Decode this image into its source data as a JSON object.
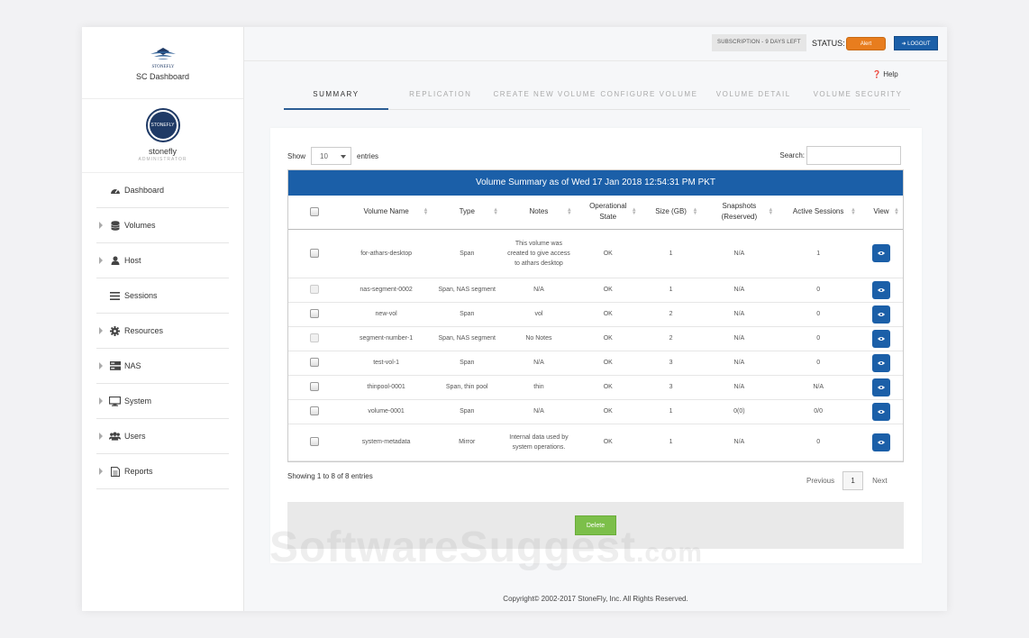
{
  "brand": {
    "logo_text": "STONEFLY",
    "title": "SC Dashboard"
  },
  "profile": {
    "avatar_text": "STONEFLY",
    "name": "stonefly",
    "role": "ADMINISTRATOR"
  },
  "sidebar": {
    "items": [
      {
        "label": "Dashboard",
        "icon": "dashboard-icon"
      },
      {
        "label": "Volumes",
        "icon": "database-icon"
      },
      {
        "label": "Host",
        "icon": "user-icon"
      },
      {
        "label": "Sessions",
        "icon": "list-icon"
      },
      {
        "label": "Resources",
        "icon": "gear-icon"
      },
      {
        "label": "NAS",
        "icon": "server-icon"
      },
      {
        "label": "System",
        "icon": "monitor-icon"
      },
      {
        "label": "Users",
        "icon": "users-icon"
      },
      {
        "label": "Reports",
        "icon": "report-icon"
      }
    ]
  },
  "topbar": {
    "subscription": "SUBSCRIPTION - 9 DAYS LEFT",
    "status_label": "STATUS:",
    "alert": "Alert",
    "logout": "LOGOUT"
  },
  "help": "Help",
  "tabs": [
    "SUMMARY",
    "REPLICATION",
    "CREATE NEW VOLUME",
    "CONFIGURE VOLUME",
    "VOLUME DETAIL",
    "VOLUME SECURITY"
  ],
  "controls": {
    "show_label": "Show",
    "show_value": "10",
    "entries_label": "entries",
    "search_label": "Search:"
  },
  "table": {
    "title": "Volume Summary as of Wed 17 Jan 2018 12:54:31 PM PKT",
    "columns": [
      "Volume Name",
      "Type",
      "Notes",
      "Operational State",
      "Size (GB)",
      "Snapshots (Reserved)",
      "Active Sessions",
      "View"
    ],
    "rows": [
      {
        "name": "for-athars-desktop",
        "type": "Span",
        "notes": "This volume was created to give access to athars desktop",
        "state": "OK",
        "size": "1",
        "snapshots": "N/A",
        "sessions": "1"
      },
      {
        "name": "nas-segment-0002",
        "type": "Span, NAS segment",
        "notes": "N/A",
        "state": "OK",
        "size": "1",
        "snapshots": "N/A",
        "sessions": "0"
      },
      {
        "name": "new-vol",
        "type": "Span",
        "notes": "vol",
        "state": "OK",
        "size": "2",
        "snapshots": "N/A",
        "sessions": "0"
      },
      {
        "name": "segment-number-1",
        "type": "Span, NAS segment",
        "notes": "No Notes",
        "state": "OK",
        "size": "2",
        "snapshots": "N/A",
        "sessions": "0"
      },
      {
        "name": "test-vol-1",
        "type": "Span",
        "notes": "N/A",
        "state": "OK",
        "size": "3",
        "snapshots": "N/A",
        "sessions": "0"
      },
      {
        "name": "thinpool-0001",
        "type": "Span, thin pool",
        "notes": "thin",
        "state": "OK",
        "size": "3",
        "snapshots": "N/A",
        "sessions": "N/A"
      },
      {
        "name": "volume-0001",
        "type": "Span",
        "notes": "N/A",
        "state": "OK",
        "size": "1",
        "snapshots": "0(0)",
        "sessions": "0/0"
      },
      {
        "name": "system-metadata",
        "type": "Mirror",
        "notes": "Internal data used by system operations.",
        "state": "OK",
        "size": "1",
        "snapshots": "N/A",
        "sessions": "0"
      }
    ]
  },
  "footer": {
    "showing": "Showing 1 to 8 of 8 entries",
    "previous": "Previous",
    "page": "1",
    "next": "Next",
    "delete": "Delete",
    "copyright": "Copyright© 2002-2017 StoneFly, Inc. All Rights Reserved."
  },
  "watermark": {
    "main": "SoftwareSuggest",
    "tld": ".com"
  },
  "colors": {
    "primary": "#1b5fa8",
    "alert": "#e87d1e",
    "success": "#7cbf4a"
  }
}
